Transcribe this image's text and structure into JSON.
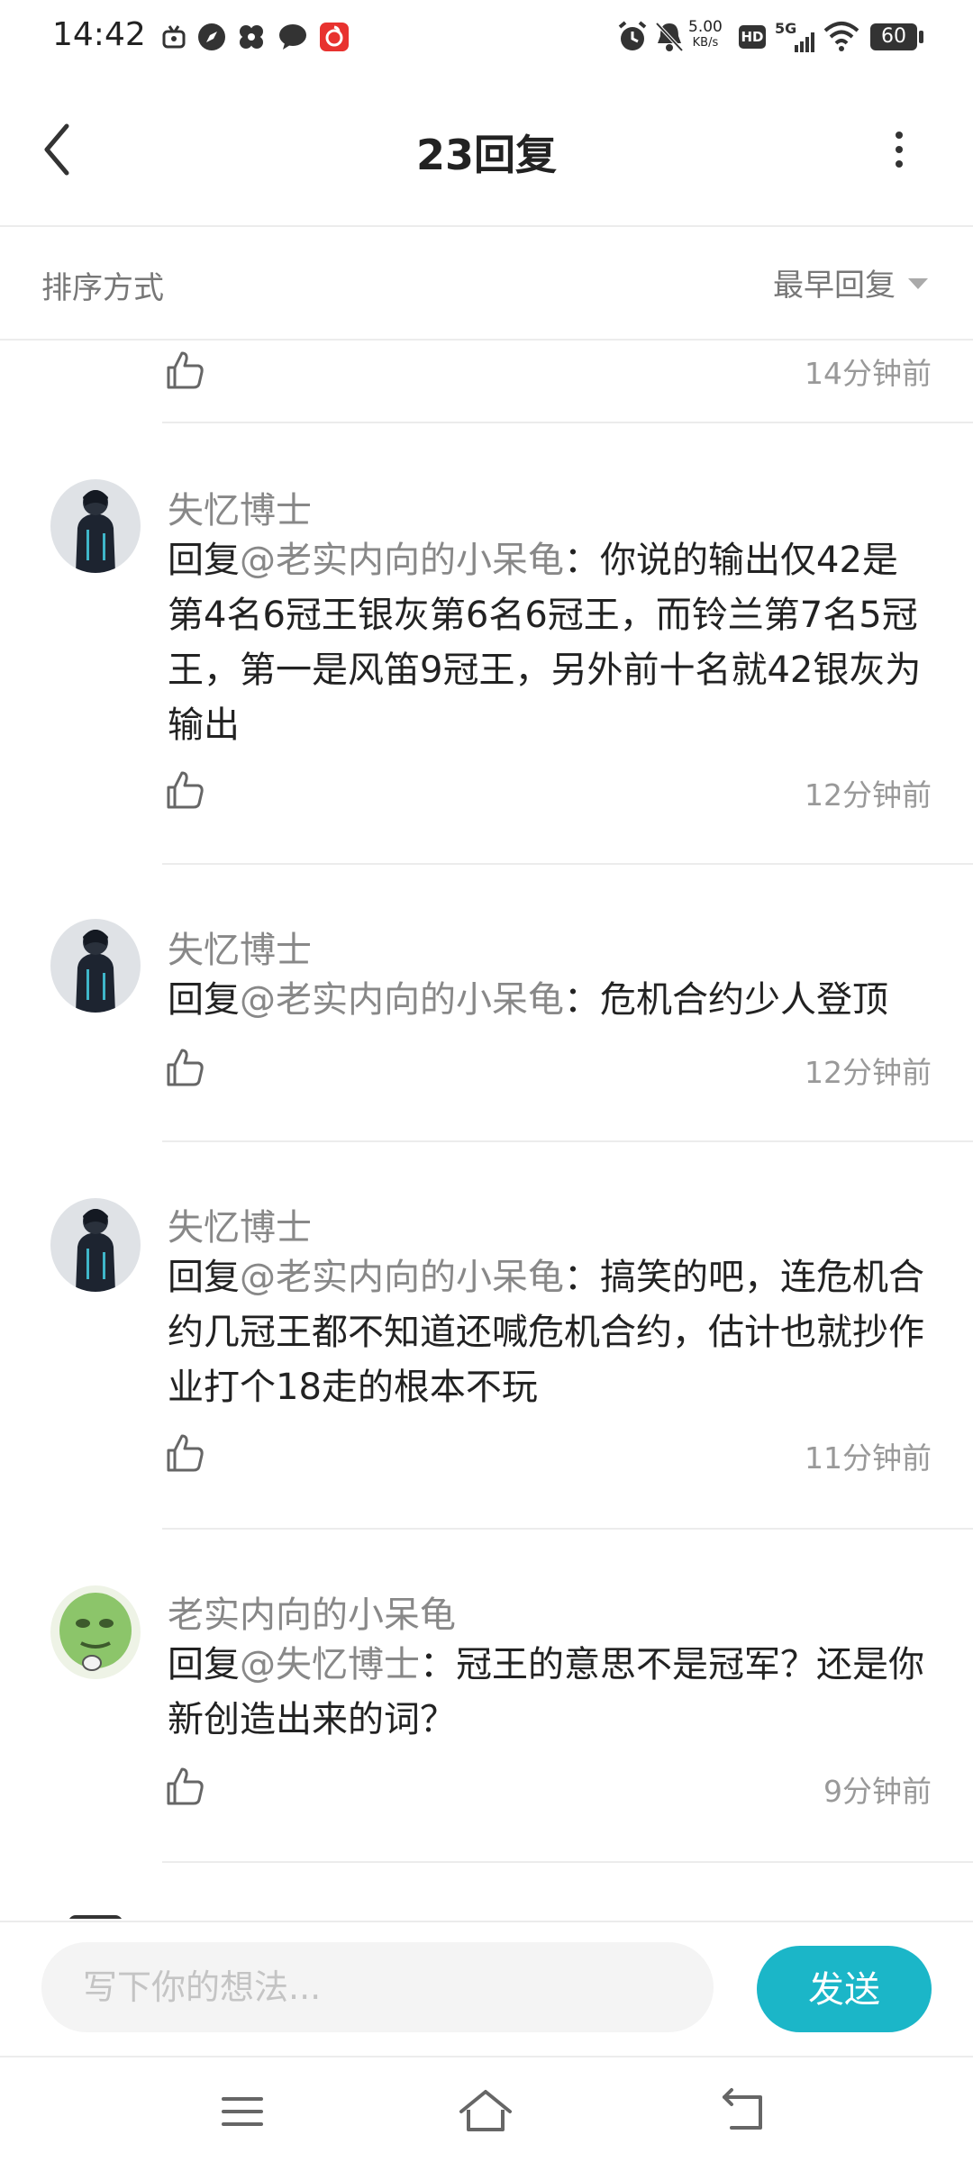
{
  "status_bar": {
    "time": "14:42",
    "net_speed_value": "5.00",
    "net_speed_unit": "KB/s",
    "hd_label": "HD",
    "network": "5G",
    "battery": "60"
  },
  "header": {
    "title": "23回复",
    "back_icon": "chevron-left-icon",
    "more_icon": "more-vertical-icon"
  },
  "sort": {
    "label": "排序方式",
    "value": "最早回复"
  },
  "replies": [
    {
      "name": "",
      "text": "",
      "time": "14分钟前"
    },
    {
      "name": "失忆博士",
      "prefix": "回复",
      "mention": "@老实内向的小呆龟",
      "text": "：你说的输出仅42是第4名6冠王银灰第6名6冠王，而铃兰第7名5冠王，第一是风笛9冠王，另外前十名就42银灰为输出",
      "time": "12分钟前"
    },
    {
      "name": "失忆博士",
      "prefix": "回复",
      "mention": "@老实内向的小呆龟",
      "text": "：危机合约少人登顶",
      "time": "12分钟前"
    },
    {
      "name": "失忆博士",
      "prefix": "回复",
      "mention": "@老实内向的小呆龟",
      "text": "：搞笑的吧，连危机合约几冠王都不知道还喊危机合约，估计也就抄作业打个18走的根本不玩",
      "time": "11分钟前"
    },
    {
      "name": "老实内向的小呆龟",
      "prefix": "回复",
      "mention": "@失忆博士",
      "text": "：冠王的意思不是冠军？还是你新创造出来的词？",
      "time": "9分钟前"
    }
  ],
  "input": {
    "placeholder": "写下你的想法...",
    "value": ""
  },
  "send_label": "发送",
  "colors": {
    "accent": "#1bb6c8",
    "mention": "#888888",
    "muted": "#999999"
  }
}
